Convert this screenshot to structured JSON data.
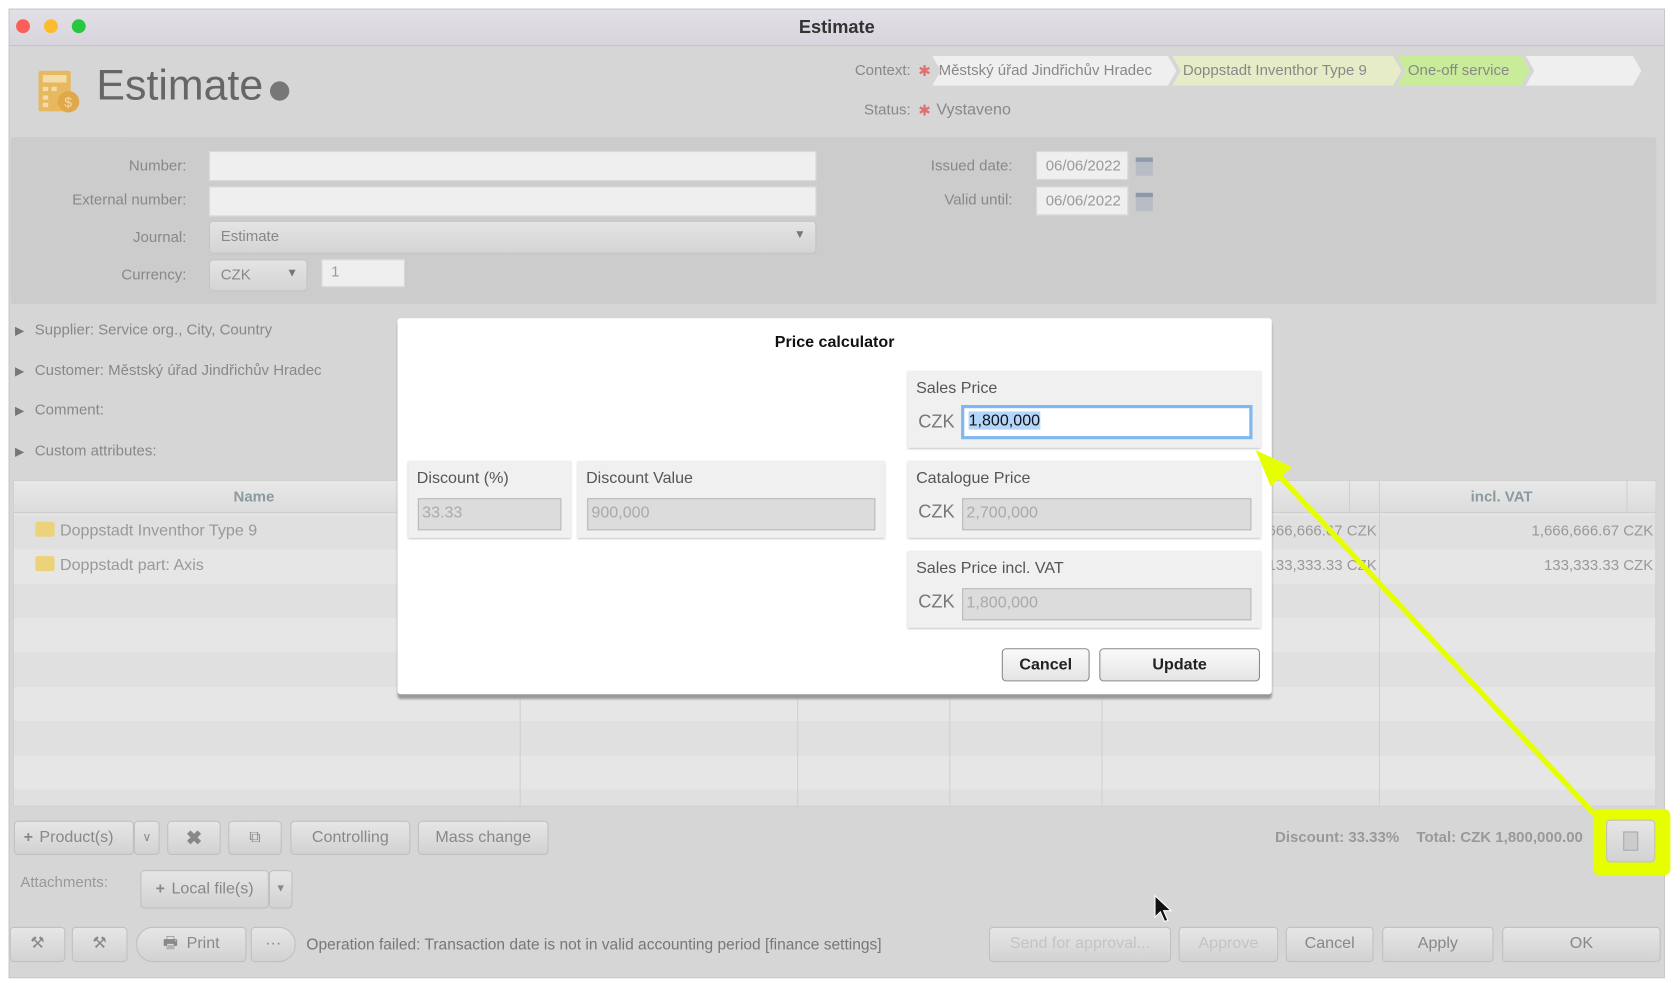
{
  "window": {
    "title": "Estimate"
  },
  "header": {
    "title": "Estimate",
    "icon": "calculator-icon"
  },
  "context": {
    "label": "Context:",
    "items": [
      "Městský úřad Jindřichův Hradec",
      "Doppstadt Inventhor Type 9",
      "One-off service",
      ""
    ]
  },
  "status": {
    "label": "Status:",
    "value": "Vystaveno"
  },
  "form": {
    "number": {
      "label": "Number:",
      "value": ""
    },
    "external_number": {
      "label": "External number:",
      "value": ""
    },
    "journal": {
      "label": "Journal:",
      "value": "Estimate"
    },
    "currency": {
      "label": "Currency:",
      "value": "CZK",
      "rate": "1"
    },
    "issued_date": {
      "label": "Issued date:",
      "value": "06/06/2022"
    },
    "valid_until": {
      "label": "Valid until:",
      "value": "06/06/2022"
    }
  },
  "sections": [
    "Supplier: Service org., City, Country",
    "Customer: Městský úřad Jindřichův Hradec",
    "Comment:",
    "Custom attributes:"
  ],
  "table": {
    "columns": {
      "name": "Name",
      "incl_vat": "incl. VAT"
    },
    "rows": [
      {
        "name": "Doppstadt Inventhor Type 9",
        "excl": "1,666,666.67 CZK",
        "incl": "1,666,666.67 CZK"
      },
      {
        "name": "Doppstadt part: Axis",
        "excl": "133,333.33 CZK",
        "incl": "133,333.33 CZK"
      }
    ]
  },
  "toolbar": {
    "products": "Product(s)",
    "controlling": "Controlling",
    "mass_change": "Mass change",
    "discount": "Discount: 33.33%",
    "total": "Total: CZK 1,800,000.00"
  },
  "attachments": {
    "label": "Attachments:",
    "local_files": "Local file(s)"
  },
  "footer": {
    "print": "Print",
    "more": "···",
    "message": "Operation failed: Transaction date is not in valid accounting period [finance settings]",
    "send": "Send for approval...",
    "approve": "Approve",
    "cancel": "Cancel",
    "apply": "Apply",
    "ok": "OK"
  },
  "dialog": {
    "title": "Price calculator",
    "sales_price": {
      "label": "Sales Price",
      "currency": "CZK",
      "value": "1,800,000"
    },
    "discount_pct": {
      "label": "Discount (%)",
      "value": "33.33"
    },
    "discount_value": {
      "label": "Discount Value",
      "value": "900,000"
    },
    "catalogue_price": {
      "label": "Catalogue Price",
      "currency": "CZK",
      "value": "2,700,000"
    },
    "sales_price_vat": {
      "label": "Sales Price incl. VAT",
      "currency": "CZK",
      "value": "1,800,000"
    },
    "cancel": "Cancel",
    "update": "Update"
  },
  "colors": {
    "highlight": "#e6ff00",
    "focus": "#7fb8f0",
    "crumb_active": "#c9ec9a",
    "crumb_mid": "#e6ecc8"
  }
}
